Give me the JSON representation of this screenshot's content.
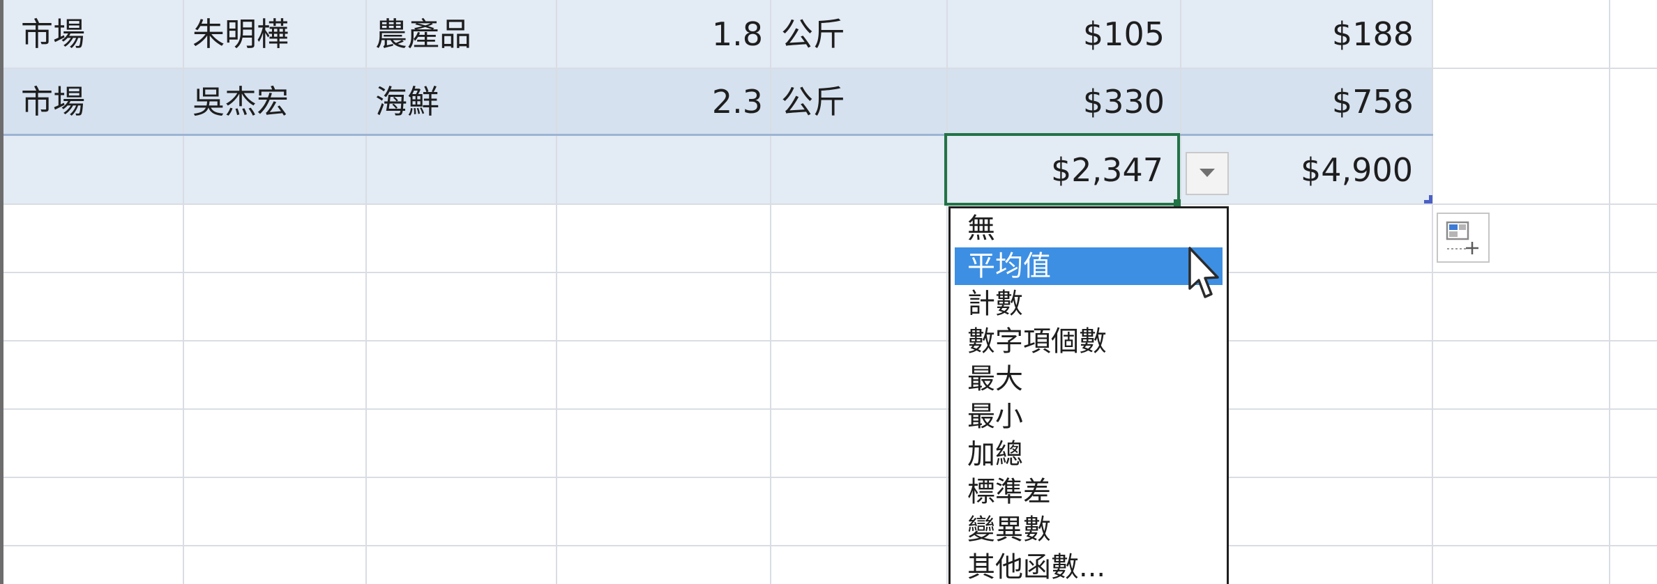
{
  "table": {
    "rows": [
      {
        "c1": "市場",
        "c2": "朱明樺",
        "c3": "農產品",
        "qty": "1.8",
        "unit": "公斤",
        "price": "$105",
        "total": "$188"
      },
      {
        "c1": "市場",
        "c2": "吳杰宏",
        "c3": "海鮮",
        "qty": "2.3",
        "unit": "公斤",
        "price": "$330",
        "total": "$758"
      }
    ],
    "total_row": {
      "price_total": "$2,347",
      "grand_total": "$4,900"
    }
  },
  "total_dropdown": {
    "options": [
      "無",
      "平均值",
      "計數",
      "數字項個數",
      "最大",
      "最小",
      "加總",
      "標準差",
      "變異數",
      "其他函數..."
    ],
    "selected": "平均值"
  },
  "icons": {
    "dropdown_arrow": "chevron-down-icon",
    "cursor": "mouse-pointer-icon",
    "quick_analysis": "quick-analysis-icon"
  },
  "colors": {
    "table_band": "#e3ebf5",
    "table_band_alt": "#d5e1ef",
    "active_border": "#217346",
    "selection": "#3d8fe3"
  }
}
